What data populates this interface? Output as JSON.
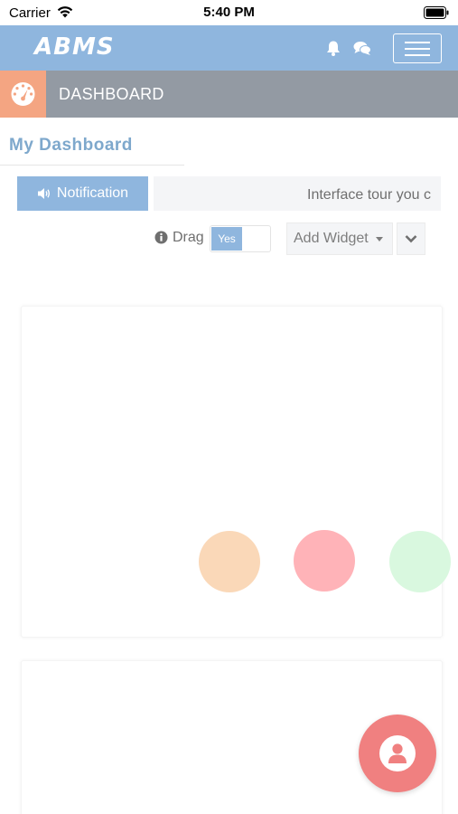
{
  "status_bar": {
    "carrier": "Carrier",
    "time": "5:40 PM"
  },
  "header": {
    "logo_text": "ABMS",
    "icons": [
      "bell-icon",
      "chat-icon",
      "menu-icon"
    ],
    "brand_color": "#8fb6de"
  },
  "breadcrumb": {
    "title": "DASHBOARD",
    "icon": "speedometer-icon",
    "icon_bg_color": "#f4a582"
  },
  "page": {
    "title": "My Dashboard"
  },
  "notification": {
    "button_label": "Notification",
    "ticker_text": "Interface tour you c"
  },
  "controls": {
    "drag_label": "Drag",
    "drag_toggle_value": "Yes",
    "add_widget_label": "Add Widget"
  },
  "widgets": {
    "loader_dot_colors": [
      "#fad8b8",
      "#ffb3b8",
      "#d9f8df"
    ]
  },
  "fab": {
    "icon": "user-icon",
    "color": "#f08080"
  }
}
